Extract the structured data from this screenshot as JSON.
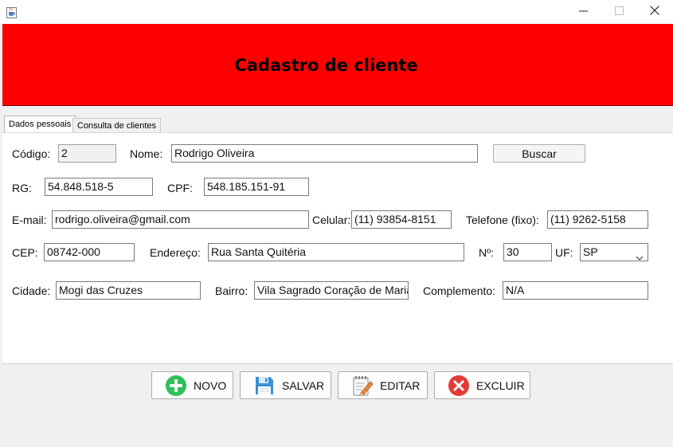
{
  "window": {
    "icon": "java-cup-icon",
    "controls": {
      "minimize": "minimize-icon",
      "maximize": "maximize-icon",
      "close": "close-icon"
    }
  },
  "header": {
    "title": "Cadastro de cliente",
    "background": "#ff0000"
  },
  "tabs": [
    {
      "label": "Dados pessoais",
      "active": true
    },
    {
      "label": "Consulta de clientes",
      "active": false
    }
  ],
  "form": {
    "codigo": {
      "label": "Código:",
      "value": "2"
    },
    "nome": {
      "label": "Nome:",
      "value": "Rodrigo Oliveira"
    },
    "buscar_label": "Buscar",
    "rg": {
      "label": "RG:",
      "value": "54.848.518-5"
    },
    "cpf": {
      "label": "CPF:",
      "value": "548.185.151-91"
    },
    "email": {
      "label": "E-mail:",
      "value": "rodrigo.oliveira@gmail.com"
    },
    "celular": {
      "label": "Celular:",
      "value": "(11) 93854-8151"
    },
    "telefone": {
      "label": "Telefone (fixo):",
      "value": "(11) 9262-5158"
    },
    "cep": {
      "label": "CEP:",
      "value": "08742-000"
    },
    "endereco": {
      "label": "Endereço:",
      "value": "Rua Santa Quitéria"
    },
    "numero": {
      "label": "Nº:",
      "value": "30"
    },
    "uf": {
      "label": "UF:",
      "value": "SP"
    },
    "cidade": {
      "label": "Cidade:",
      "value": "Mogi das Cruzes"
    },
    "bairro": {
      "label": "Bairro:",
      "value": "Vila Sagrado Coração de Maria"
    },
    "complemento": {
      "label": "Complemento:",
      "value": "N/A"
    }
  },
  "actions": {
    "novo": {
      "label": "NOVO",
      "icon": "plus-circle-icon",
      "color": "#2fbf58"
    },
    "salvar": {
      "label": "SALVAR",
      "icon": "floppy-disk-icon",
      "color": "#3b8fd6"
    },
    "editar": {
      "label": "EDITAR",
      "icon": "notepad-pencil-icon",
      "color": "#e8893a"
    },
    "excluir": {
      "label": "EXCLUIR",
      "icon": "x-circle-icon",
      "color": "#e53935"
    }
  }
}
